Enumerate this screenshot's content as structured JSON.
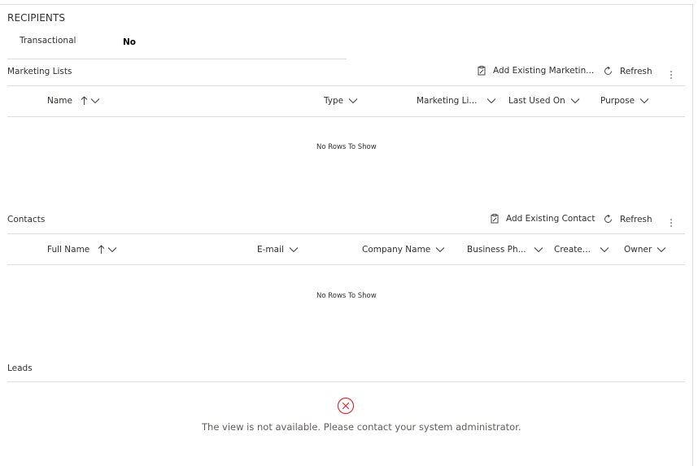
{
  "recipients": {
    "title": "RECIPIENTS",
    "field_label": "Transactional",
    "field_value": "No"
  },
  "marketing_lists": {
    "title": "Marketing Lists",
    "add_label": "Add Existing Marketin...",
    "refresh_label": "Refresh",
    "columns": [
      "Name",
      "Type",
      "Marketing Li...",
      "Last Used On",
      "Purpose"
    ],
    "empty_text": "No Rows To Show"
  },
  "contacts": {
    "title": "Contacts",
    "add_label": "Add Existing Contact",
    "refresh_label": "Refresh",
    "columns": [
      "Full Name",
      "E-mail",
      "Company Name",
      "Business Ph...",
      "Create...",
      "Owner"
    ],
    "empty_text": "No Rows To Show"
  },
  "leads": {
    "title": "Leads",
    "error_text": "The view is not available. Please contact your system administrator."
  },
  "colors": {
    "divider": "#e1dfdd",
    "error": "#d13438",
    "text": "#323130"
  }
}
